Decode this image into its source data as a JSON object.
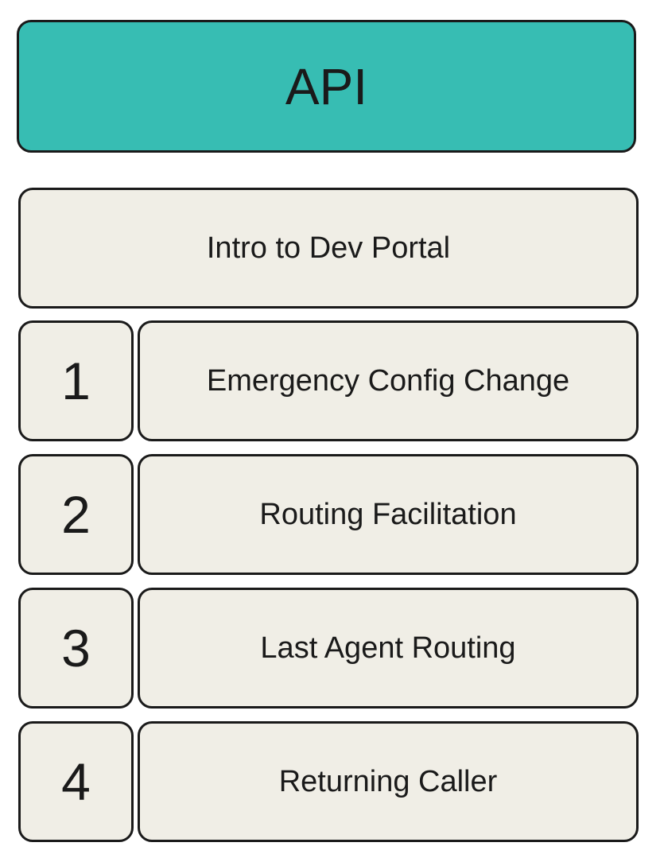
{
  "header": {
    "title": "API"
  },
  "intro": {
    "label": "Intro to Dev Portal"
  },
  "steps": [
    {
      "number": "1",
      "label": "Emergency Config Change"
    },
    {
      "number": "2",
      "label": "Routing Facilitation"
    },
    {
      "number": "3",
      "label": "Last Agent Routing"
    },
    {
      "number": "4",
      "label": "Returning Caller"
    }
  ],
  "colors": {
    "header_fill": "#37bdb3",
    "box_fill": "#f0eee6",
    "border": "#1a1a1a"
  }
}
